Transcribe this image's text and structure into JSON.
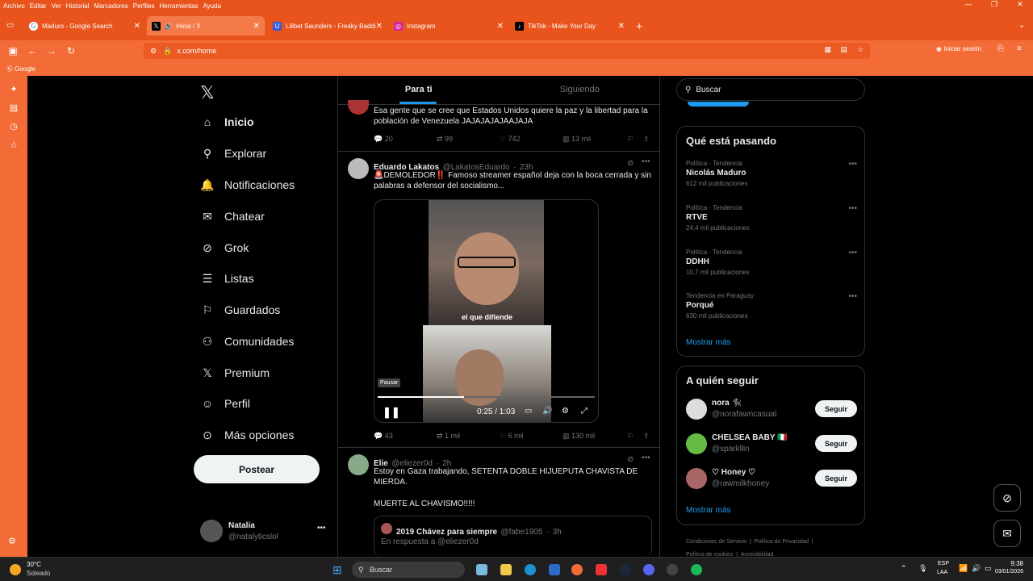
{
  "menubar": {
    "items": [
      "Archivo",
      "Editar",
      "Ver",
      "Historial",
      "Marcadores",
      "Perfiles",
      "Herramientas",
      "Ayuda"
    ]
  },
  "tabs": [
    {
      "title": "Maduro - Google Search",
      "favicon": "google-icon"
    },
    {
      "title": "Inicio / X",
      "favicon": "x-icon",
      "active": true
    },
    {
      "title": "Lilibet Saunders - Freaky Baddi",
      "favicon": "shield-icon"
    },
    {
      "title": "Instagram",
      "favicon": "instagram-icon"
    },
    {
      "title": "TikTok - Make Your Day",
      "favicon": "tiktok-icon"
    }
  ],
  "urlbar": {
    "url": "x.com/home",
    "signin": "Iniciar sesión"
  },
  "bookmarks": {
    "google": "Google"
  },
  "nav": {
    "items": [
      "Inicio",
      "Explorar",
      "Notificaciones",
      "Chatear",
      "Grok",
      "Listas",
      "Guardados",
      "Comunidades",
      "Premium",
      "Perfil",
      "Más opciones"
    ],
    "post_button": "Postear",
    "user": {
      "name": "Natalia",
      "handle": "@natalyticslol"
    }
  },
  "feed": {
    "tabs": [
      "Para ti",
      "Siguiendo"
    ],
    "tweet0": {
      "text": "Esa gente que se cree que Estados Unidos quiere la paz y la libertad para la población de Venezuela JAJAJAJAJAAJAJA",
      "replies": "20",
      "reposts": "99",
      "likes": "742",
      "views": "13 mil"
    },
    "tweet1": {
      "name": "Eduardo Lakatos",
      "handle": "@LakatosEduardo",
      "time": "23h",
      "text": "🚨DEMOLEDOR‼️ Famoso streamer español deja con la boca cerrada y sin palabras a defensor del socialismo...",
      "video_caption": "el que difiende",
      "pause_tooltip": "Pausar",
      "time_display": "0:25 / 1:03",
      "progress": 0.397,
      "replies": "43",
      "reposts": "1 mil",
      "likes": "6 mil",
      "views": "130 mil"
    },
    "tweet2": {
      "name": "Elie",
      "handle": "@eliezer0d",
      "time": "2h",
      "text": "Estoy en Gaza trabajando, SETENTA DOBLE HIJUEPUTA CHAVISTA DE MIERDA.",
      "text2": "MUERTE AL CHAVISMO!!!!!",
      "quote": {
        "name": "2019 Chávez para siempre",
        "handle": "@fabe1905",
        "time": "3h",
        "reply_to": "En respuesta a @eliezer0d"
      }
    }
  },
  "right": {
    "search_placeholder": "Buscar",
    "trending_title": "Qué está pasando",
    "trends": [
      {
        "context": "Política · Tendencia",
        "title": "Nicolás Maduro",
        "count": "612 mil publicaciones"
      },
      {
        "context": "Política · Tendencia",
        "title": "RTVE",
        "count": "24,4 mil publicaciones"
      },
      {
        "context": "Política · Tendencia",
        "title": "DDHH",
        "count": "10,7 mil publicaciones"
      },
      {
        "context": "Tendencia en Paraguay",
        "title": "Porqué",
        "count": "630 mil publicaciones"
      }
    ],
    "show_more": "Mostrar más",
    "who_title": "A quién seguir",
    "who": [
      {
        "name": "nora 🐈‍⬛",
        "handle": "@norafawncasual"
      },
      {
        "name": "CHELSEA BABY 🇮🇹",
        "handle": "@sparkllin"
      },
      {
        "name": "♡ Honey ♡",
        "handle": "@rawmilkhoney"
      }
    ],
    "follow": "Seguir",
    "footer": [
      "Condiciones de Servicio",
      "Política de Privacidad",
      "Política de cookies",
      "Accesibilidad"
    ]
  },
  "taskbar": {
    "weather_temp": "30°C",
    "weather_desc": "Soleado",
    "search": "Buscar",
    "lang": "ESP",
    "lang2": "LAA",
    "time": "9:38",
    "date": "03/01/2026"
  },
  "colors": {
    "brand_orange": "#e8541c",
    "x_blue": "#1d9bf0",
    "bg": "#000000"
  }
}
